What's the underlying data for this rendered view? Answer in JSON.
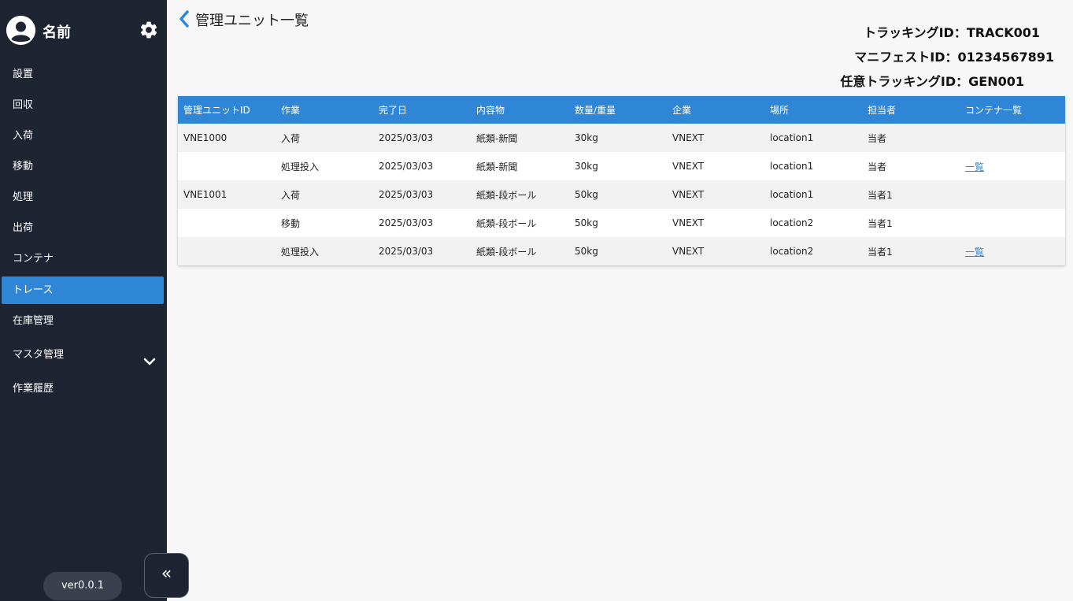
{
  "sidebar": {
    "user_name": "名前",
    "items": [
      {
        "label": "設置"
      },
      {
        "label": "回収"
      },
      {
        "label": "入荷"
      },
      {
        "label": "移動"
      },
      {
        "label": "処理"
      },
      {
        "label": "出荷"
      },
      {
        "label": "コンテナ"
      },
      {
        "label": "トレース",
        "active": true
      },
      {
        "label": "在庫管理"
      },
      {
        "label": "マスタ管理",
        "expandable": true
      },
      {
        "label": "作業履歴"
      }
    ],
    "version": "ver0.0.1",
    "collapse_glyph": "«"
  },
  "header": {
    "title": "管理ユニット一覧",
    "tracking_id": "トラッキングID：TRACK001",
    "manifest_id": "マニフェストID：01234567891",
    "optional_tracking_id": "任意トラッキングID：GEN001"
  },
  "table": {
    "columns": [
      "管理ユニットID",
      "作業",
      "完了日",
      "内容物",
      "数量/重量",
      "企業",
      "場所",
      "担当者",
      "コンテナ一覧"
    ],
    "rows": [
      [
        "VNE1000",
        "入荷",
        "2025/03/03",
        "紙類-新聞",
        "30kg",
        "VNEXT",
        "location1",
        "当者",
        ""
      ],
      [
        "",
        "処理投入",
        "2025/03/03",
        "紙類-新聞",
        "30kg",
        "VNEXT",
        "location1",
        "当者",
        "一覧"
      ],
      [
        "VNE1001",
        "入荷",
        "2025/03/03",
        "紙類-段ボール",
        "50kg",
        "VNEXT",
        "location1",
        "当者1",
        ""
      ],
      [
        "",
        "移動",
        "2025/03/03",
        "紙類-段ボール",
        "50kg",
        "VNEXT",
        "location2",
        "当者1",
        ""
      ],
      [
        "",
        "処理投入",
        "2025/03/03",
        "紙類-段ボール",
        "50kg",
        "VNEXT",
        "location2",
        "当者1",
        "一覧"
      ]
    ]
  },
  "colors": {
    "sidebar_bg": "#1f2433",
    "accent": "#2f86d6",
    "page_bg": "#f7f7f7"
  },
  "icons": {
    "avatar": "user-circle-icon",
    "settings": "gear-icon",
    "back": "chevron-left-icon",
    "expand": "chevron-down-icon",
    "collapse": "double-chevron-left-icon"
  }
}
